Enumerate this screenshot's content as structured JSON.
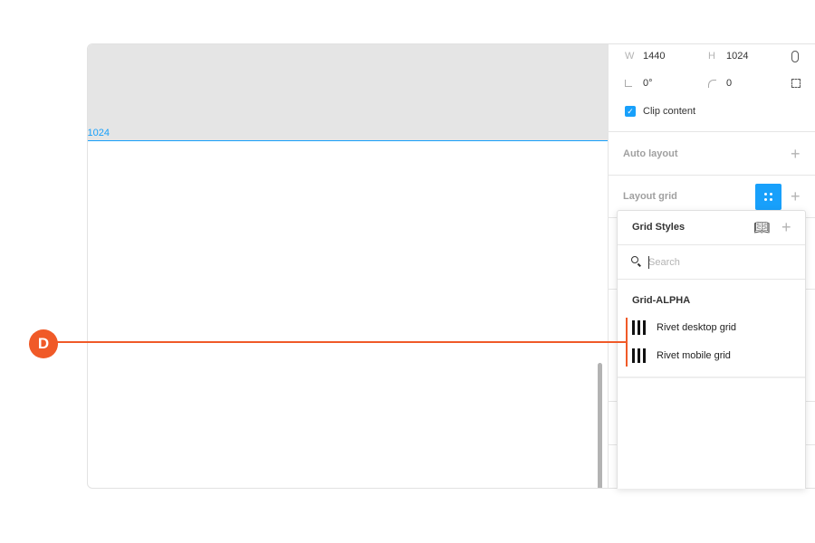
{
  "canvas": {
    "frame_label": "x1024"
  },
  "properties": {
    "width_label": "W",
    "width": "1440",
    "height_label": "H",
    "height": "1024",
    "rotation": "0°",
    "radius": "0",
    "clip_content": {
      "label": "Clip content",
      "checked": true
    },
    "auto_layout": "Auto layout",
    "layout_grid": "Layout grid"
  },
  "grid_styles": {
    "title": "Grid Styles",
    "search_placeholder": "Search",
    "library": "Grid-ALPHA",
    "items": [
      {
        "label": "Rivet desktop grid"
      },
      {
        "label": "Rivet mobile grid"
      }
    ]
  },
  "annotation": {
    "label": "D",
    "color": "#f05a28"
  },
  "colors": {
    "accent": "#18a0fb"
  }
}
